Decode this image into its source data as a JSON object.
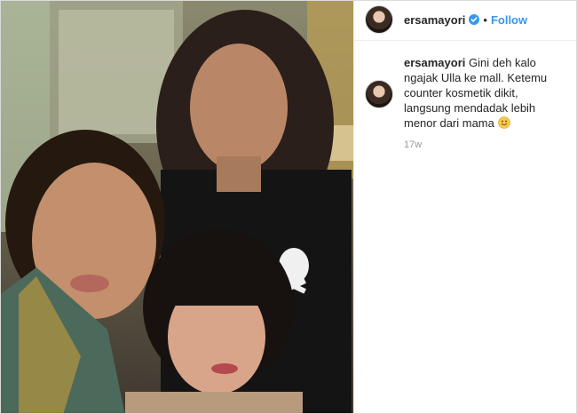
{
  "header": {
    "username": "ersamayori",
    "separator": "•",
    "follow_label": "Follow"
  },
  "caption": {
    "username": "ersamayori",
    "text": "Gini deh kalo ngajak Ulla ke mall. Ketemu counter kosmetik dikit, langsung mendadak lebih menor dari mama",
    "emoji": "slightly-smiling-face",
    "time": "17w"
  },
  "colors": {
    "follow_blue": "#3897f0",
    "verified_blue": "#3897f0",
    "text": "#262626",
    "muted": "#999999"
  },
  "photo": {
    "description_icon": "photo-image"
  }
}
